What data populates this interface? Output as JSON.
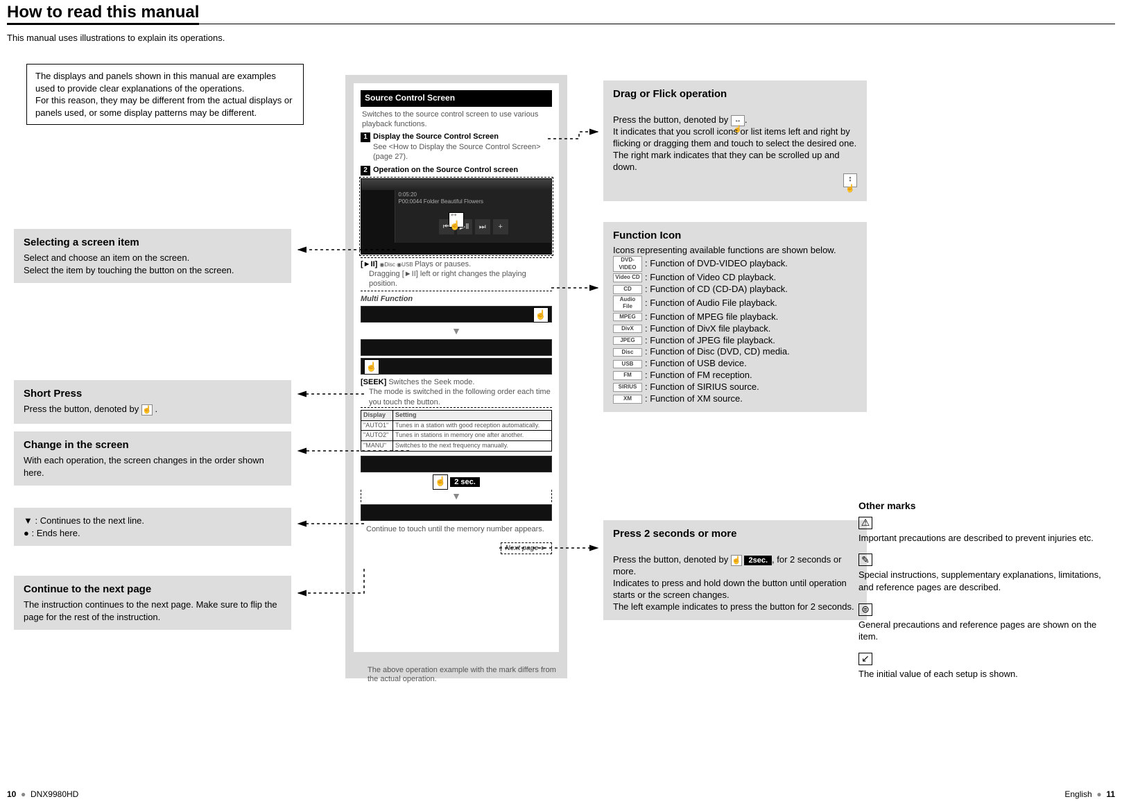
{
  "title": "How to read this manual",
  "intro": "This manual uses illustrations to explain its operations.",
  "note_box": "The displays and panels shown in this manual are examples used to provide clear explanations of the operations.\nFor this reason, they may be different from the actual displays or panels used, or some display patterns may be different.",
  "callouts": {
    "select": {
      "title": "Selecting a screen item",
      "body": "Select and choose an item on the screen.\nSelect the item by touching the button on the screen."
    },
    "short": {
      "title": "Short Press",
      "body_prefix": "Press the button, denoted by ",
      "body_suffix": " ."
    },
    "change": {
      "title": "Change in the screen",
      "body": "With each operation, the screen changes in the order shown here."
    },
    "continues": {
      "line1_prefix": "▼ ",
      "line1": ": Continues to the next line.",
      "line2_prefix": "● ",
      "line2": ": Ends here."
    },
    "nextpage": {
      "title": "Continue to the next page",
      "body": "The instruction continues to the next page. Make sure to flip the page for the rest of the instruction."
    },
    "drag": {
      "title": "Drag or Flick operation",
      "body_prefix": "Press the button, denoted by ",
      "body_mid": ".\nIt indicates that you scroll icons or list items left and right by flicking or dragging them and touch to select the desired one.\nThe right mark indicates that they can be scrolled up and down."
    },
    "func": {
      "title": "Function Icon",
      "intro": "Icons representing available functions are shown below.",
      "items": [
        {
          "badge": "DVD-VIDEO",
          "text": ": Function of DVD-VIDEO playback."
        },
        {
          "badge": "Video CD",
          "text": ": Function of Video CD playback."
        },
        {
          "badge": "CD",
          "text": ": Function of CD (CD-DA) playback."
        },
        {
          "badge": "Audio File",
          "text": ": Function of Audio File playback."
        },
        {
          "badge": "MPEG",
          "text": ": Function of MPEG file playback."
        },
        {
          "badge": "DivX",
          "text": ": Function of DivX file playback."
        },
        {
          "badge": "JPEG",
          "text": ": Function of JPEG file playback."
        },
        {
          "badge": "Disc",
          "text": ": Function of Disc (DVD, CD) media."
        },
        {
          "badge": "USB",
          "text": ": Function of USB device."
        },
        {
          "badge": "FM",
          "text": ": Function of FM reception."
        },
        {
          "badge": "SIRIUS",
          "text": ": Function of SIRIUS source."
        },
        {
          "badge": "XM",
          "text": ": Function of XM source."
        }
      ]
    },
    "press2": {
      "title": "Press 2 seconds or more",
      "body_prefix": "Press the button, denoted by ",
      "two_sec": "2sec.",
      "body_mid": ", for 2 seconds or more.\nIndicates to press and hold down the button until operation starts or the screen changes.\nThe left example indicates to press the button for 2 seconds."
    }
  },
  "center": {
    "header": "Source Control Screen",
    "sub": "Switches to the source control screen to use various playback functions.",
    "step1": "Display the Source Control Screen",
    "step1_note": "See <How to Display the Source Control Screen> (page 27).",
    "step2": "Operation on the Source Control screen",
    "screen_info_time": "0:05:20",
    "screen_info_folder": "P00:0044   Folder   Beautiful Flowers",
    "play_label": "[►II]",
    "play_desc": "Plays or pauses.",
    "play_note": "Dragging [►II] left or right changes the playing position.",
    "multi_label": "Multi Function",
    "seek_label": "[SEEK]",
    "seek_desc": "Switches the Seek mode.",
    "seek_note": "The mode is switched in the following order each time you touch the button.",
    "table": {
      "h1": "Display",
      "h2": "Setting",
      "rows": [
        {
          "d": "\"AUTO1\"",
          "s": "Tunes in a station with good reception automatically."
        },
        {
          "d": "\"AUTO2\"",
          "s": "Tunes in stations in memory one after another."
        },
        {
          "d": "\"MANU\"",
          "s": "Switches to the next frequency manually."
        }
      ]
    },
    "two_sec_label": "2 sec.",
    "memory_note": "Continue to touch until the memory number appears.",
    "next_page": "Next page ►"
  },
  "below_caption": "The above operation example with the mark differs from the actual operation.",
  "other_marks": {
    "title": "Other marks",
    "items": [
      {
        "icon": "⚠",
        "text": "Important precautions are described to prevent injuries etc."
      },
      {
        "icon": "✎",
        "text": "Special instructions, supplementary explanations, limitations, and reference pages are described."
      },
      {
        "icon": "⊜",
        "text": "General precautions and reference pages are shown on the item."
      },
      {
        "icon": "↙",
        "text": "The initial value of each setup is shown."
      }
    ]
  },
  "footer": {
    "left_page": "10",
    "model": "DNX9980HD",
    "lang": "English",
    "right_page": "11"
  }
}
